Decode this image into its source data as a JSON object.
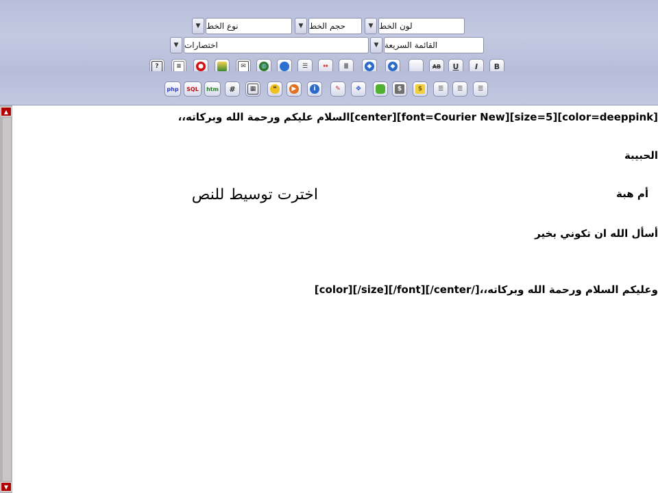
{
  "toolbar": {
    "font_color_label": "لون الخط",
    "font_size_label": "حجم الخط",
    "font_type_label": "نوع الخط",
    "quick_menu_label": "القائمة السريعة",
    "shortcuts_label": "اختصارات",
    "bold_label": "B",
    "italic_label": "I",
    "underline_label": "U",
    "strike_label": "AB",
    "php_label": "php",
    "sql_label": "SQL",
    "htm_label": "htm",
    "hash_label": "#",
    "help_label": "?"
  },
  "editor": {
    "line1_tags": "[center][font=Courier New][size=5][color=deeppink]",
    "line1_text": "السلام عليكم ورحمة الله وبركاته،،",
    "line2": "الحبيبة",
    "line3": "أم هبة",
    "line3_note": "اخترت توسيط للنص",
    "line4": "أسأل الله ان تكوني بخير",
    "line5_text": "وعليكم السلام ورحمة الله وبركاته،،",
    "line5_tags": "[color][/size][/font][/center/]"
  },
  "colors": {
    "toolbar_bg": "#bcc1dc",
    "scroll_arrow": "#b20000",
    "scroll_track": "#b5b3b3"
  }
}
